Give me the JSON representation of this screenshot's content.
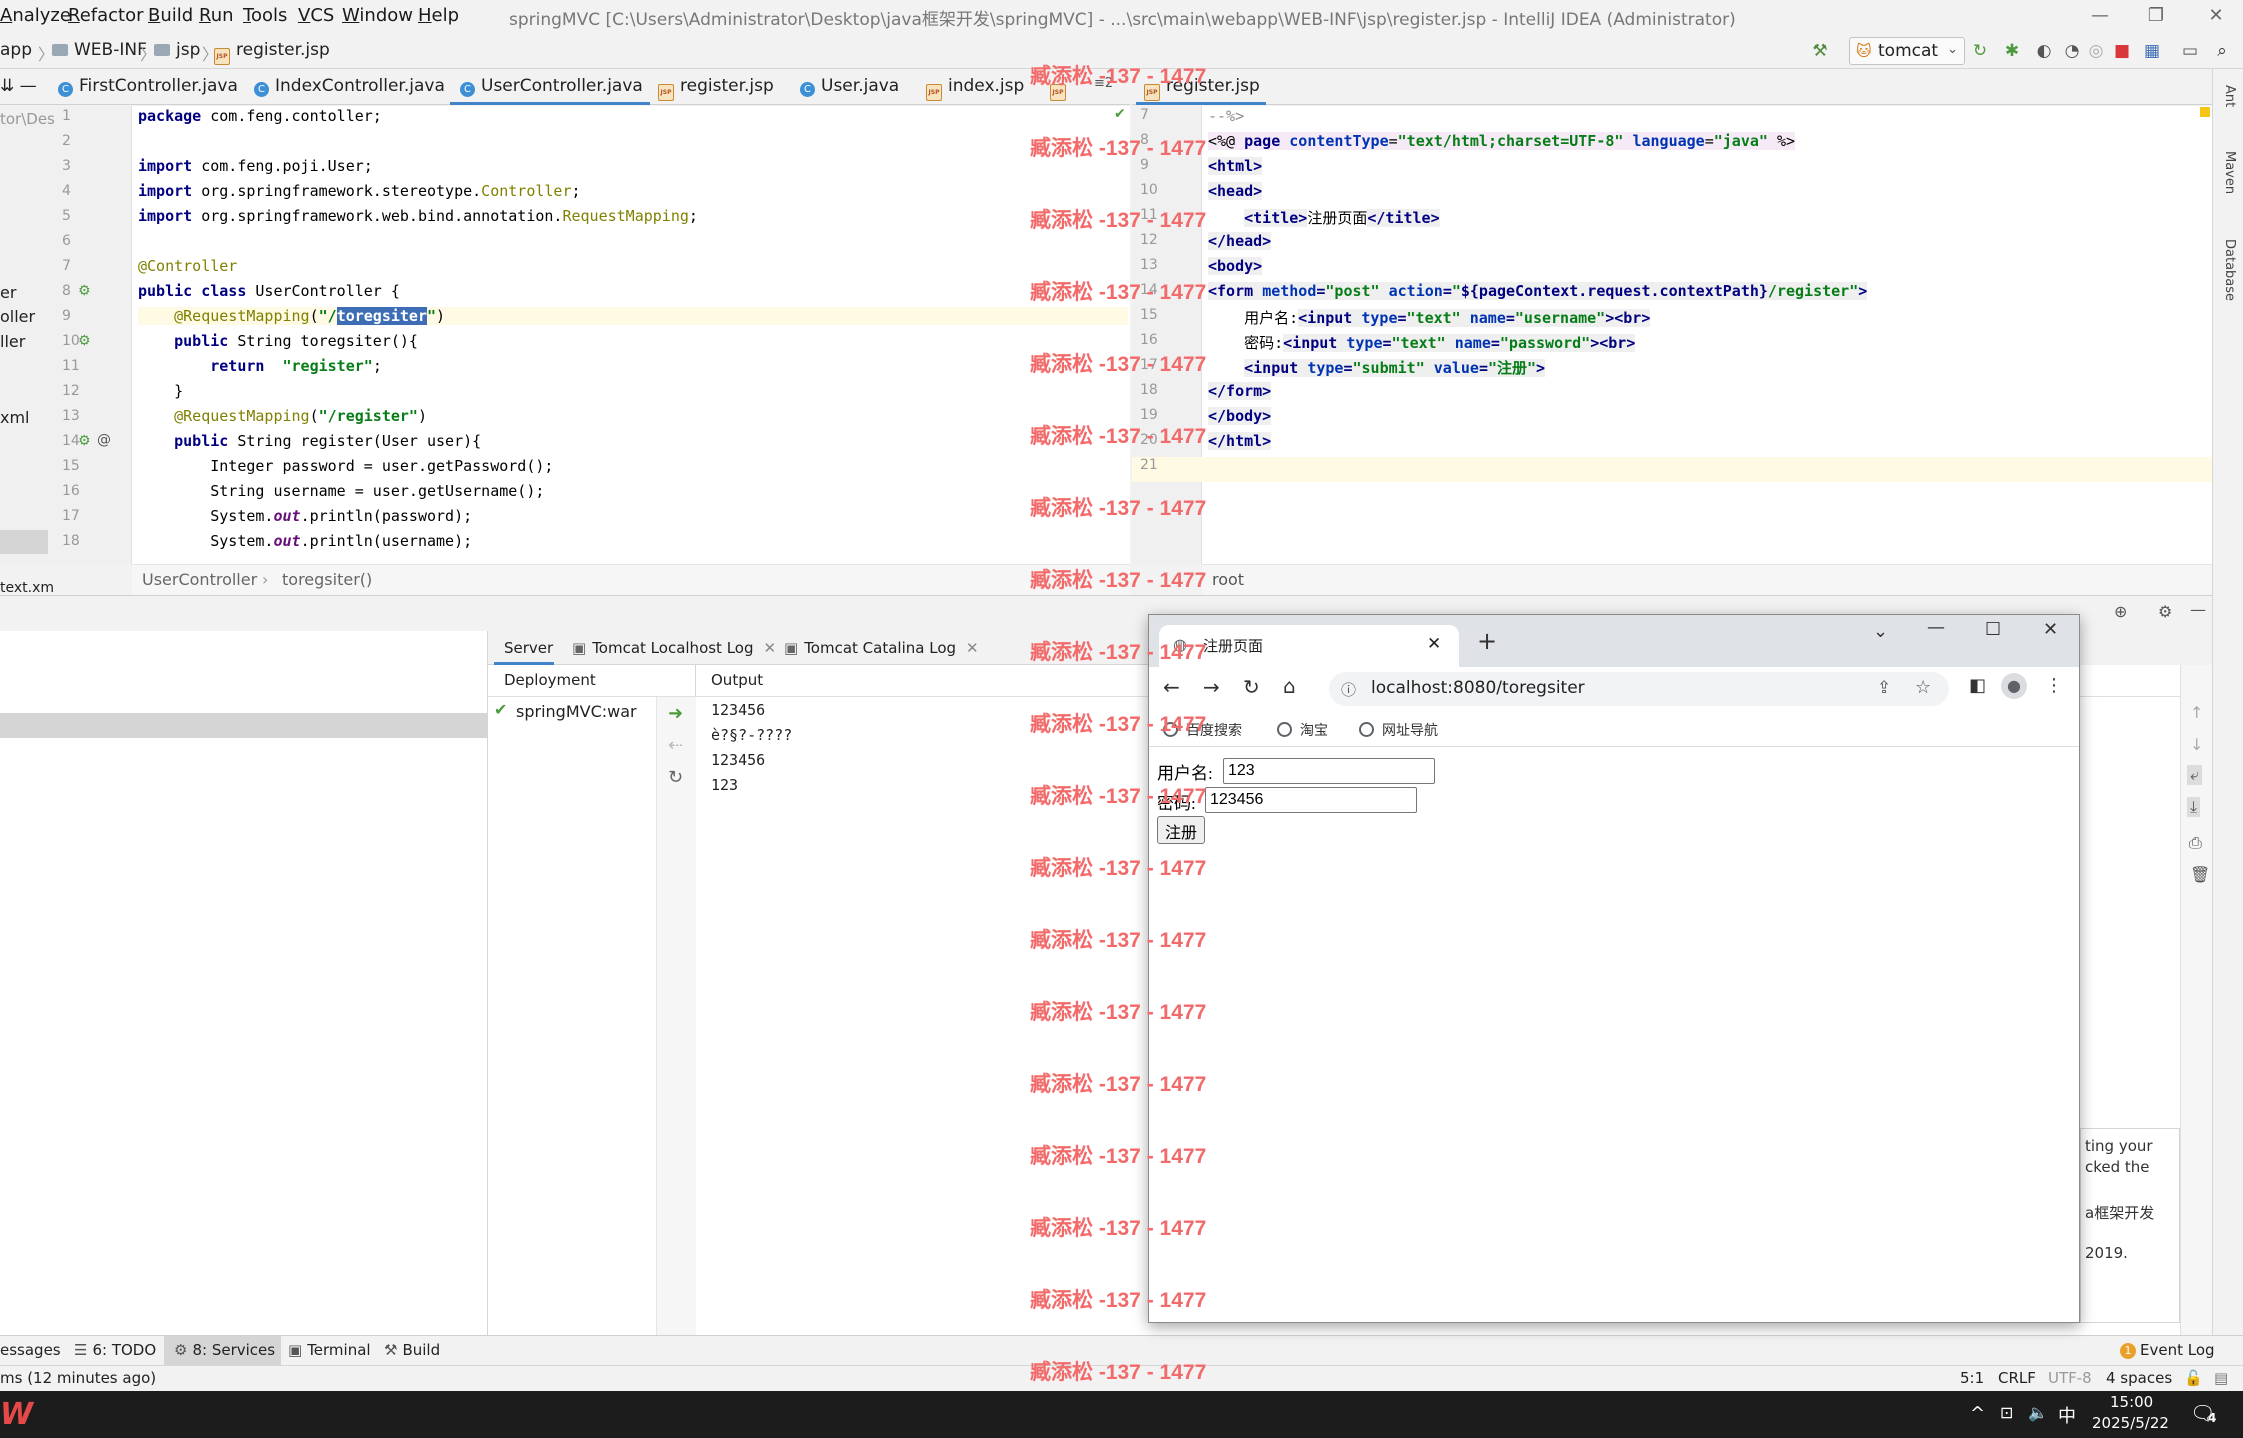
{
  "window": {
    "title": "springMVC [C:\\Users\\Administrator\\Desktop\\java框架开发\\springMVC] - ...\\src\\main\\webapp\\WEB-INF\\jsp\\register.jsp - IntelliJ IDEA (Administrator)"
  },
  "menu": [
    "Analyze",
    "Refactor",
    "Build",
    "Run",
    "Tools",
    "VCS",
    "Window",
    "Help"
  ],
  "nav": {
    "crumbs": [
      "app",
      "WEB-INF",
      "jsp",
      "register.jsp"
    ],
    "run_config": "tomcat"
  },
  "tabs_left": [
    {
      "label": "FirstController.java"
    },
    {
      "label": "IndexController.java"
    },
    {
      "label": "UserController.java"
    },
    {
      "label": "register.jsp"
    },
    {
      "label": "User.java"
    },
    {
      "label": "index.jsp"
    }
  ],
  "tab_overflow": "≡2",
  "tab_right": {
    "label": "register.jsp"
  },
  "editor_left": {
    "line_numbers": [
      "1",
      "2",
      "3",
      "4",
      "5",
      "6",
      "7",
      "8",
      "9",
      "10",
      "11",
      "12",
      "13",
      "14",
      "15",
      "16",
      "17",
      "18"
    ],
    "breadcrumb": [
      "UserController",
      "toregsiter()"
    ]
  },
  "editor_right": {
    "line_numbers": [
      "7",
      "8",
      "9",
      "10",
      "11",
      "12",
      "13",
      "14",
      "15",
      "16",
      "17",
      "18",
      "19",
      "20",
      "21"
    ],
    "breadcrumb": "root"
  },
  "project_sliver": [
    "tor\\Des",
    "er",
    "oller",
    "ller",
    "xml",
    "text.xm"
  ],
  "services": {
    "tabs": [
      "Server",
      "Tomcat Localhost Log",
      "Tomcat Catalina Log"
    ],
    "deployment_header": "Deployment",
    "deployment_item": "springMVC:war",
    "output_header": "Output",
    "output_lines": [
      "123456",
      "è?§?-????",
      "123456",
      "123"
    ]
  },
  "browser": {
    "tab_title": "注册页面",
    "url": "localhost:8080/toregsiter",
    "bookmarks": [
      "百度搜索",
      "淘宝",
      "网址导航"
    ],
    "form": {
      "username_label": "用户名:",
      "username_value": "123",
      "password_label": "密码:",
      "password_value": "123456",
      "submit_label": "注册"
    }
  },
  "notification_lines": [
    "ting your",
    "cked the",
    "a框架开发",
    "2019."
  ],
  "toolwindows": [
    "essages",
    "6: TODO",
    "8: Services",
    "Terminal",
    "Build"
  ],
  "event_log": {
    "count": "1",
    "label": "Event Log"
  },
  "status": {
    "message": "ms (12 minutes ago)",
    "position": "5:1",
    "line_sep": "CRLF",
    "encoding": "UTF-8",
    "indent": "4 spaces"
  },
  "taskbar": {
    "ime": "中",
    "time": "15:00",
    "date": "2025/5/22",
    "notif_count": "4"
  },
  "watermark": "臧添松 -137 - 1477",
  "right_strip_labels": [
    "Ant",
    "Maven",
    "Database"
  ],
  "colors": {
    "accent": "#4083c9",
    "watermark": "#f26a6a",
    "selection": "#3d6eb5"
  }
}
